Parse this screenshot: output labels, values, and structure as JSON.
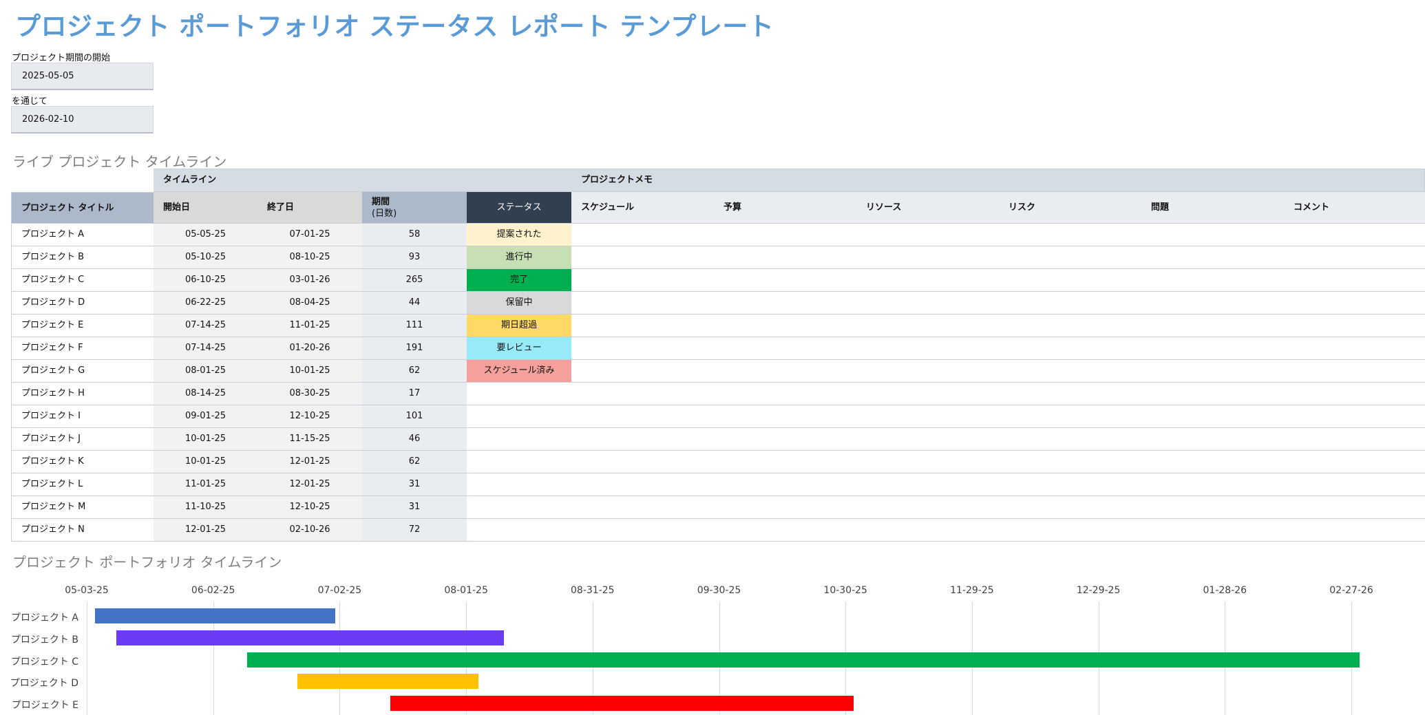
{
  "title": "プロジェクト ポートフォリオ ステータス レポート テンプレート",
  "period_start": {
    "label": "プロジェクト期間の開始",
    "value": "2025-05-05"
  },
  "period_end": {
    "label": "を通じて",
    "value": "2026-02-10"
  },
  "live_timeline_title": "ライブ プロジェクト タイムライン",
  "table": {
    "group_timeline": "タイムライン",
    "group_notes": "プロジェクトメモ",
    "headers": {
      "title": "プロジェクト タイトル",
      "start": "開始日",
      "end": "終了日",
      "duration": "期間",
      "duration_unit": "(日数)",
      "status": "ステータス",
      "schedule": "スケジュール",
      "budget": "予算",
      "resources": "リソース",
      "risk": "リスク",
      "issues": "問題",
      "comments": "コメント"
    },
    "rows": [
      {
        "name": "プロジェクト A",
        "start": "05-05-25",
        "end": "07-01-25",
        "duration": "58",
        "status": "提案された",
        "status_color": "#fff2cc"
      },
      {
        "name": "プロジェクト B",
        "start": "05-10-25",
        "end": "08-10-25",
        "duration": "93",
        "status": "進行中",
        "status_color": "#c6e0b4"
      },
      {
        "name": "プロジェクト C",
        "start": "06-10-25",
        "end": "03-01-26",
        "duration": "265",
        "status": "完了",
        "status_color": "#00b050"
      },
      {
        "name": "プロジェクト D",
        "start": "06-22-25",
        "end": "08-04-25",
        "duration": "44",
        "status": "保留中",
        "status_color": "#d9d9d9"
      },
      {
        "name": "プロジェクト E",
        "start": "07-14-25",
        "end": "11-01-25",
        "duration": "111",
        "status": "期日超過",
        "status_color": "#ffd966"
      },
      {
        "name": "プロジェクト F",
        "start": "07-14-25",
        "end": "01-20-26",
        "duration": "191",
        "status": "要レビュー",
        "status_color": "#97ebf9"
      },
      {
        "name": "プロジェクト G",
        "start": "08-01-25",
        "end": "10-01-25",
        "duration": "62",
        "status": "スケジュール済み",
        "status_color": "#f4a09c"
      },
      {
        "name": "プロジェクト H",
        "start": "08-14-25",
        "end": "08-30-25",
        "duration": "17",
        "status": "",
        "status_color": ""
      },
      {
        "name": "プロジェクト I",
        "start": "09-01-25",
        "end": "12-10-25",
        "duration": "101",
        "status": "",
        "status_color": ""
      },
      {
        "name": "プロジェクト J",
        "start": "10-01-25",
        "end": "11-15-25",
        "duration": "46",
        "status": "",
        "status_color": ""
      },
      {
        "name": "プロジェクト K",
        "start": "10-01-25",
        "end": "12-01-25",
        "duration": "62",
        "status": "",
        "status_color": ""
      },
      {
        "name": "プロジェクト L",
        "start": "11-01-25",
        "end": "12-01-25",
        "duration": "31",
        "status": "",
        "status_color": ""
      },
      {
        "name": "プロジェクト M",
        "start": "11-10-25",
        "end": "12-10-25",
        "duration": "31",
        "status": "",
        "status_color": ""
      },
      {
        "name": "プロジェクト N",
        "start": "12-01-25",
        "end": "02-10-26",
        "duration": "72",
        "status": "",
        "status_color": ""
      }
    ]
  },
  "portfolio_timeline_title": "プロジェクト ポートフォリオ タイムライン",
  "chart_data": {
    "type": "gantt",
    "x_ticks": [
      "05-03-25",
      "06-02-25",
      "07-02-25",
      "08-01-25",
      "08-31-25",
      "09-30-25",
      "10-30-25",
      "11-29-25",
      "12-29-25",
      "01-28-26",
      "02-27-26"
    ],
    "tick_interval_days": 30,
    "series": [
      {
        "label": "プロジェクト A",
        "start": "2025-05-05",
        "end": "2025-07-01",
        "color": "#4472c4"
      },
      {
        "label": "プロジェクト B",
        "start": "2025-05-10",
        "end": "2025-08-10",
        "color": "#6a3cf5"
      },
      {
        "label": "プロジェクト C",
        "start": "2025-06-10",
        "end": "2026-03-01",
        "color": "#00b050"
      },
      {
        "label": "プロジェクト D",
        "start": "2025-06-22",
        "end": "2025-08-04",
        "color": "#ffc000"
      },
      {
        "label": "プロジェクト E",
        "start": "2025-07-14",
        "end": "2025-11-01",
        "color": "#ff0000"
      }
    ],
    "grid": true
  }
}
